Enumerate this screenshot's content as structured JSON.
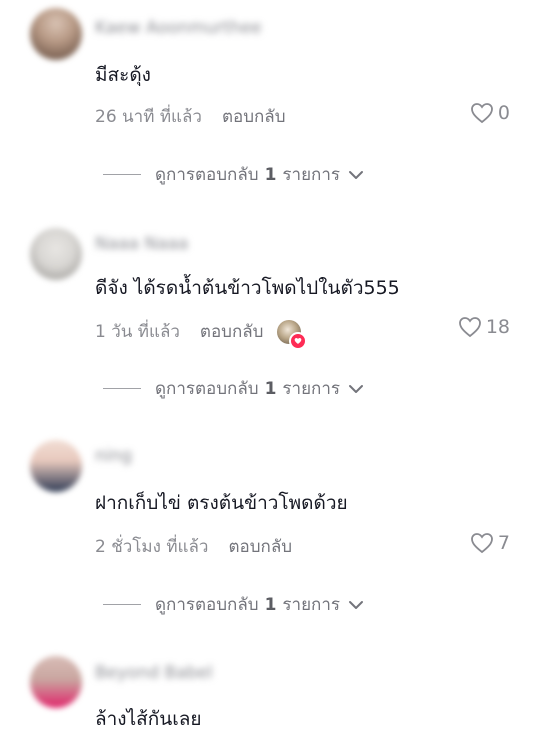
{
  "comments": [
    {
      "username": "Kaew Aoonmurthee",
      "avatar_colors": [
        "#b89a86",
        "#5b4438"
      ],
      "text": "มีสะดุ้ง",
      "time": "26 นาที ที่แล้ว",
      "reply_label": "ตอบกลับ",
      "likes": "0",
      "view_replies": {
        "prefix": "ดูการตอบกลับ",
        "count": "1",
        "suffix": "รายการ"
      }
    },
    {
      "username": "Naaa Naaa",
      "avatar_colors": [
        "#d8d6d3",
        "#8e8c88"
      ],
      "text": "ดีจัง ได้รดน้ำต้นข้าวโพดไปในตัว555",
      "time": "1 วัน ที่แล้ว",
      "reply_label": "ตอบกลับ",
      "likes": "18",
      "view_replies": {
        "prefix": "ดูการตอบกลับ",
        "count": "1",
        "suffix": "รายการ"
      }
    },
    {
      "username": "ning",
      "avatar_colors": [
        "#e8c9bd",
        "#2f3b55"
      ],
      "text": "ฝากเก็บไข่ ตรงต้นข้าวโพดด้วย",
      "time": "2 ชั่วโมง ที่แล้ว",
      "reply_label": "ตอบกลับ",
      "likes": "7",
      "view_replies": {
        "prefix": "ดูการตอบกลับ",
        "count": "1",
        "suffix": "รายการ"
      }
    },
    {
      "username": "Beyond Babel",
      "avatar_colors": [
        "#c9a6a0",
        "#e0246a"
      ],
      "text": "ล้างไส้กันเลย"
    }
  ],
  "colors": {
    "accent": "#fe2c55",
    "muted": "#8a8b91",
    "text": "#161823"
  },
  "icons": {
    "like": "heart-outline-icon",
    "expand": "chevron-down-icon",
    "creator_liked": "creator-liked-heart-icon"
  }
}
